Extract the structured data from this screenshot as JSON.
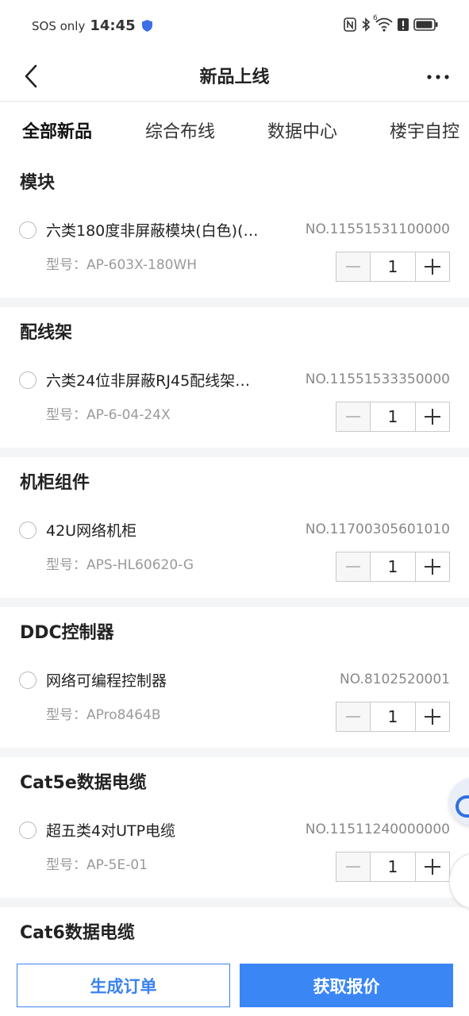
{
  "status_bar": {
    "carrier": "SOS only",
    "time": "14:45",
    "icons": [
      "shield-icon",
      "nfc-icon",
      "bluetooth-icon",
      "wifi-icon",
      "alert-icon",
      "battery-icon"
    ],
    "wifi_badge": "6"
  },
  "nav": {
    "title": "新品上线",
    "back_icon": "chevron-left-icon",
    "more_icon": "more-dots-icon"
  },
  "tabs": [
    {
      "label": "全部新品",
      "active": true
    },
    {
      "label": "综合布线",
      "active": false
    },
    {
      "label": "数据中心",
      "active": false
    },
    {
      "label": "楼宇自控",
      "active": false
    }
  ],
  "sections": [
    {
      "title": "模块",
      "item": {
        "name": "六类180度非屏蔽模块(白色)(…",
        "no": "NO.11551531100000",
        "model": "型号：AP-603X-180WH",
        "qty": "1"
      }
    },
    {
      "title": "配线架",
      "item": {
        "name": "六类24位非屏蔽RJ45配线架…",
        "no": "NO.11551533350000",
        "model": "型号：AP-6-04-24X",
        "qty": "1"
      }
    },
    {
      "title": "机柜组件",
      "item": {
        "name": "42U网络机柜",
        "no": "NO.11700305601010",
        "model": "型号：APS-HL60620-G",
        "qty": "1"
      }
    },
    {
      "title": "DDC控制器",
      "item": {
        "name": "网络可编程控制器",
        "no": "NO.8102520001",
        "model": "型号：APro8464B",
        "qty": "1"
      }
    },
    {
      "title": "Cat5e数据电缆",
      "item": {
        "name": "超五类4对UTP电缆",
        "no": "NO.11511240000000",
        "model": "型号：AP-5E-01",
        "qty": "1"
      }
    }
  ],
  "partial_section": {
    "title": "Cat6数据电缆"
  },
  "actions": {
    "order_label": "生成订单",
    "quote_label": "获取报价"
  },
  "colors": {
    "accent": "#3a86f5",
    "text": "#222222",
    "muted": "#9a9a9a",
    "divider": "#f4f5f7"
  }
}
